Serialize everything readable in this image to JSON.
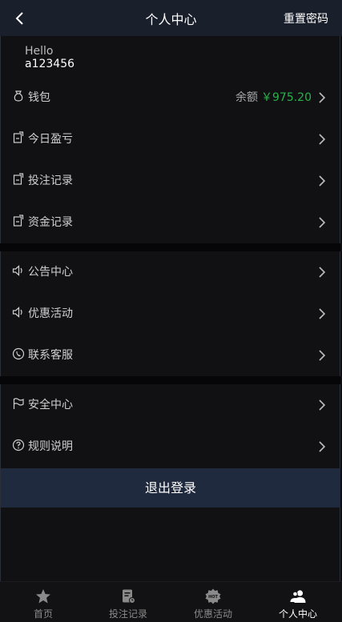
{
  "header": {
    "title": "个人中心",
    "reset_label": "重置密码"
  },
  "profile": {
    "greeting": "Hello",
    "username": "a123456"
  },
  "wallet": {
    "label": "钱包",
    "balance_label": "余额",
    "balance_value": "￥975.20",
    "balance_color": "#27b34a"
  },
  "menu_group_1": [
    {
      "label": "今日盈亏",
      "icon": "clipboard-icon"
    },
    {
      "label": "投注记录",
      "icon": "clipboard-icon"
    },
    {
      "label": "资金记录",
      "icon": "clipboard-icon"
    }
  ],
  "menu_group_2": [
    {
      "label": "公告中心",
      "icon": "speaker-icon"
    },
    {
      "label": "优惠活动",
      "icon": "speaker-icon"
    },
    {
      "label": "联系客服",
      "icon": "phone-icon"
    }
  ],
  "menu_group_3": [
    {
      "label": "安全中心",
      "icon": "flag-icon"
    },
    {
      "label": "规则说明",
      "icon": "question-icon"
    }
  ],
  "logout_label": "退出登录",
  "tabbar": [
    {
      "label": "首页",
      "icon": "star-icon",
      "active": false
    },
    {
      "label": "投注记录",
      "icon": "document-icon",
      "active": false
    },
    {
      "label": "优惠活动",
      "icon": "hot-badge-icon",
      "active": false
    },
    {
      "label": "个人中心",
      "icon": "users-icon",
      "active": true
    }
  ],
  "colors": {
    "header_bg": "#1a1f2c",
    "logout_bg": "#202a3e",
    "page_bg": "#111114"
  }
}
